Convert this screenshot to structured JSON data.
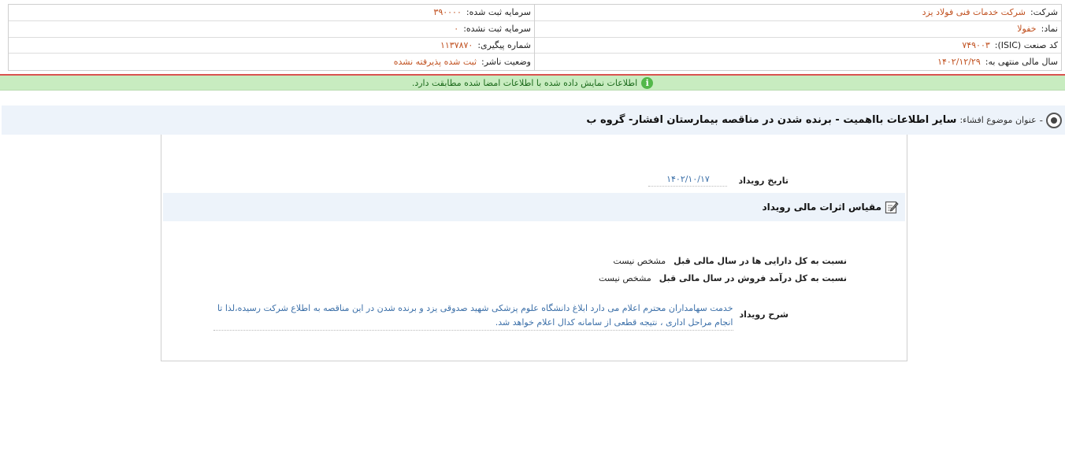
{
  "header": {
    "company_label": "شرکت:",
    "company_value": "شرکت خدمات فنی فولاد یزد",
    "symbol_label": "نماد:",
    "symbol_value": "خفولا",
    "industry_label": "کد صنعت (ISIC):",
    "industry_value": "۷۴۹۰۰۳",
    "fiscal_label": "سال مالی منتهی به:",
    "fiscal_value": "۱۴۰۲/۱۲/۲۹",
    "reg_capital_label": "سرمایه ثبت شده:",
    "reg_capital_value": "۳۹۰۰۰۰",
    "unreg_capital_label": "سرمایه ثبت نشده:",
    "unreg_capital_value": "۰",
    "tracking_label": "شماره پیگیری:",
    "tracking_value": "۱۱۳۷۸۷۰",
    "publisher_status_label": "وضعیت ناشر:",
    "publisher_status_value": "ثبت شده پذیرفته نشده"
  },
  "banner": {
    "message": "اطلاعات نمایش داده شده با اطلاعات امضا شده مطابقت دارد.",
    "icon": "info-icon",
    "color": "#53b84a"
  },
  "title_bar": {
    "dash": "-",
    "label": "عنوان موضوع افشاء:",
    "text": "سایر اطلاعات بااهمیت - برنده شدن در مناقصه بیمارستان افشار- گروه ب"
  },
  "content": {
    "event_date_label": "تاریخ رویداد",
    "event_date_value": "۱۴۰۲/۱۰/۱۷",
    "section_title": "مقیاس اثرات مالی رویداد",
    "ratio_assets_label": "نسبت به کل دارایی ها در سال مالی قبل",
    "ratio_assets_value": "مشخص نیست",
    "ratio_revenue_label": "نسبت به کل درآمد فروش در سال مالی قبل",
    "ratio_revenue_value": "مشخص نیست",
    "description_label": "شرح رویداد",
    "description_text": "خدمت سهامداران محترم اعلام می دارد ابلاغ دانشگاه علوم پزشکی شهید صدوقی یزد و برنده شدن در این مناقصه به اطلاع شرکت رسیده،لذا تا انجام مراحل اداری ، نتیجه قطعی از سامانه کدال اعلام خواهد شد."
  }
}
